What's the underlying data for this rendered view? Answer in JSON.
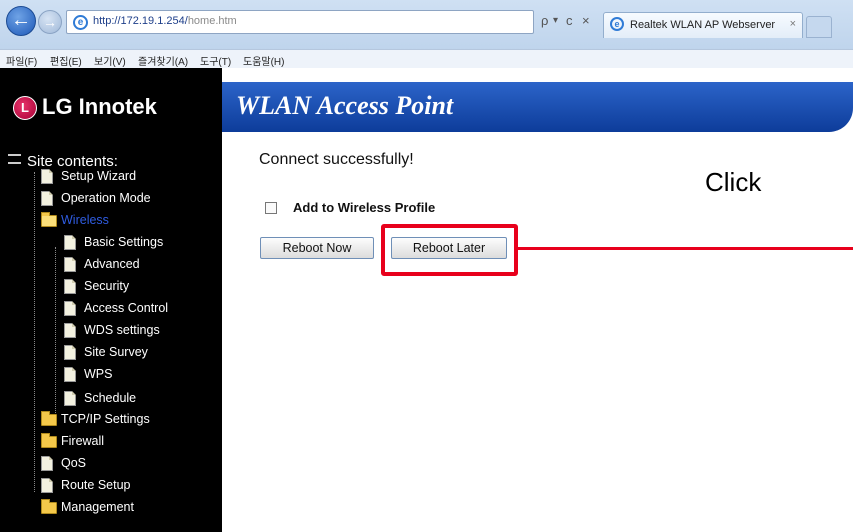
{
  "browser": {
    "url_host": "http://172.19.1.254/",
    "url_path": "home.htm",
    "address_tools": {
      "search": "ρ",
      "dropdown": "▾",
      "refresh": "ᴄ",
      "stop": "×"
    },
    "tab_title": "Realtek WLAN AP Webserver",
    "tab_close": "×",
    "menu": [
      "파일(F)",
      "편집(E)",
      "보기(V)",
      "즐겨찾기(A)",
      "도구(T)",
      "도움말(H)"
    ]
  },
  "header": {
    "brand": "LG Innotek",
    "product_title": "WLAN Access Point"
  },
  "sidebar": {
    "heading": "Site contents:",
    "items": [
      {
        "label": "Setup Wizard",
        "icon": "doc"
      },
      {
        "label": "Operation Mode",
        "icon": "doc"
      },
      {
        "label": "Wireless",
        "icon": "folder-open",
        "active": true
      },
      {
        "label": "Basic Settings",
        "icon": "doc"
      },
      {
        "label": "Advanced",
        "icon": "doc"
      },
      {
        "label": "Security",
        "icon": "doc"
      },
      {
        "label": "Access Control",
        "icon": "doc"
      },
      {
        "label": "WDS settings",
        "icon": "doc"
      },
      {
        "label": "Site Survey",
        "icon": "doc"
      },
      {
        "label": "WPS",
        "icon": "doc"
      },
      {
        "label": "Schedule",
        "icon": "doc"
      },
      {
        "label": "TCP/IP Settings",
        "icon": "folder"
      },
      {
        "label": "Firewall",
        "icon": "folder"
      },
      {
        "label": "QoS",
        "icon": "doc"
      },
      {
        "label": "Route Setup",
        "icon": "doc"
      },
      {
        "label": "Management",
        "icon": "folder"
      }
    ]
  },
  "main": {
    "status_message": "Connect successfully!",
    "checkbox_label": "Add to Wireless Profile",
    "checkbox_checked": false,
    "reboot_now_label": "Reboot Now",
    "reboot_later_label": "Reboot Later",
    "annotation_label": "Click"
  },
  "colors": {
    "accent_red": "#e8001c",
    "header_blue": "#1a4fb3",
    "active_item": "#2f5ce0"
  }
}
